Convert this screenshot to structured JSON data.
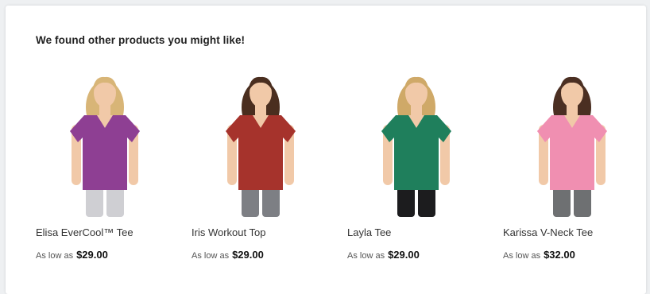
{
  "section": {
    "heading": "We found other products you might like!"
  },
  "products": [
    {
      "name": "Elisa EverCool™ Tee",
      "price_label": "As low as",
      "price": "$29.00",
      "shirt_color": "#8e3f93",
      "bottom_color": "#cfcfd3",
      "hair_color": "#d8b577"
    },
    {
      "name": "Iris Workout Top",
      "price_label": "As low as",
      "price": "$29.00",
      "shirt_color": "#a6332c",
      "bottom_color": "#7d7f84",
      "hair_color": "#4a2e1f"
    },
    {
      "name": "Layla Tee",
      "price_label": "As low as",
      "price": "$29.00",
      "shirt_color": "#1f7f5c",
      "bottom_color": "#1c1c1e",
      "hair_color": "#cfa968"
    },
    {
      "name": "Karissa V-Neck Tee",
      "price_label": "As low as",
      "price": "$32.00",
      "shirt_color": "#f08fb1",
      "bottom_color": "#6e7072",
      "hair_color": "#4b2f22"
    }
  ],
  "colors": {
    "skin": "#f1c9a8",
    "background": "#ffffff"
  }
}
